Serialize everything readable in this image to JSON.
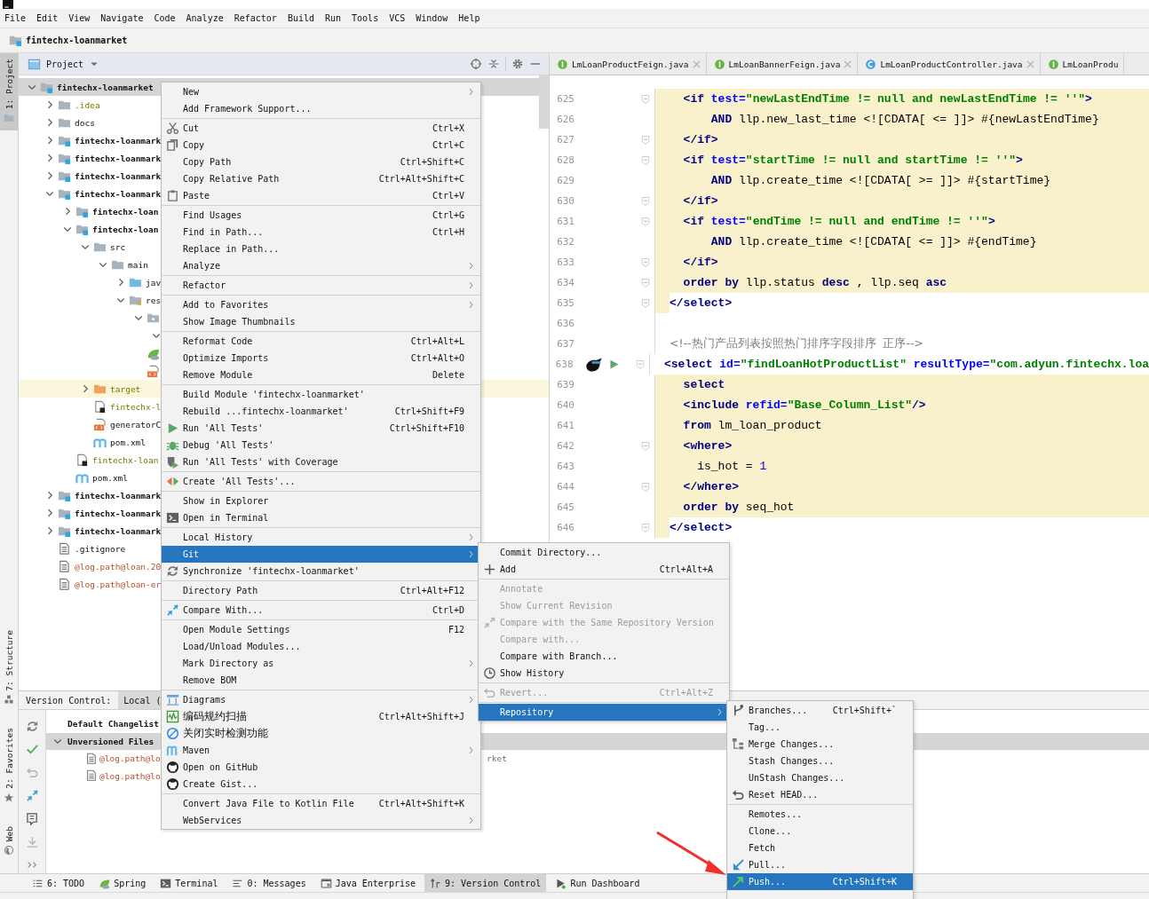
{
  "menu_bar": [
    "File",
    "Edit",
    "View",
    "Navigate",
    "Code",
    "Analyze",
    "Refactor",
    "Build",
    "Run",
    "Tools",
    "VCS",
    "Window",
    "Help"
  ],
  "breadcrumb": "fintechx-loanmarket",
  "tool_strip": [
    {
      "label": "1: Project",
      "selected": true
    },
    {
      "label": "7: Structure",
      "selected": false
    },
    {
      "label": "2: Favorites",
      "selected": false
    },
    {
      "label": "Web",
      "selected": false
    }
  ],
  "project": {
    "title": "Project",
    "tree": [
      {
        "name": "fintechx-loanmarket",
        "kind": "module",
        "selected": true,
        "expanded": true,
        "children": [
          {
            "name": ".idea",
            "kind": "folder",
            "ignored": true,
            "selected": false,
            "expanded": false
          },
          {
            "name": "docs",
            "kind": "folder",
            "selected": false,
            "expanded": false
          },
          {
            "name": "fintechx-loanmark",
            "kind": "module",
            "selected": false,
            "expanded": false
          },
          {
            "name": "fintechx-loanmark",
            "kind": "module",
            "selected": false,
            "expanded": false
          },
          {
            "name": "fintechx-loanmark",
            "kind": "module",
            "selected": false,
            "expanded": false
          },
          {
            "name": "fintechx-loanmark",
            "kind": "module",
            "selected": false,
            "expanded": true,
            "children": [
              {
                "name": "fintechx-loan",
                "kind": "module",
                "selected": false,
                "expanded": false
              },
              {
                "name": "fintechx-loan",
                "kind": "module",
                "selected": false,
                "expanded": true,
                "children": [
                  {
                    "name": "src",
                    "kind": "folder",
                    "selected": false,
                    "expanded": true,
                    "children": [
                      {
                        "name": "main",
                        "kind": "folder",
                        "selected": false,
                        "expanded": true,
                        "children": [
                          {
                            "name": "jav",
                            "kind": "source",
                            "selected": false,
                            "expanded": false
                          },
                          {
                            "name": "res",
                            "kind": "resources",
                            "selected": false,
                            "expanded": true,
                            "children": [
                              {
                                "kind": "package",
                                "selected": false,
                                "expanded": true,
                                "children": [
                                  {
                                    "selected": false,
                                    "expanded": true
                                  }
                                ]
                              },
                              {
                                "kind": "spring",
                                "selected": false
                              },
                              {
                                "kind": "xml",
                                "selected": false
                              }
                            ]
                          }
                        ]
                      }
                    ]
                  },
                  {
                    "name": "target",
                    "kind": "excluded",
                    "ignored": true,
                    "selected": false,
                    "highlighted": true,
                    "expanded": false
                  },
                  {
                    "name": "fintechx-l",
                    "kind": "iml",
                    "ignored": true,
                    "selected": false
                  },
                  {
                    "name": "generatorC",
                    "kind": "xml",
                    "selected": false
                  },
                  {
                    "name": "pom.xml",
                    "kind": "maven",
                    "selected": false
                  }
                ]
              },
              {
                "name": "fintechx-loan",
                "kind": "iml",
                "ignored": true,
                "selected": false
              },
              {
                "name": "pom.xml",
                "kind": "maven",
                "selected": false
              }
            ]
          },
          {
            "name": "fintechx-loanmark",
            "kind": "module",
            "selected": false,
            "expanded": false
          },
          {
            "name": "fintechx-loanmark",
            "kind": "module",
            "selected": false,
            "expanded": false
          },
          {
            "name": "fintechx-loanmark",
            "kind": "module",
            "selected": false,
            "expanded": false
          },
          {
            "name": ".gitignore",
            "kind": "text",
            "selected": false
          },
          {
            "name": "@log.path@loan.20",
            "kind": "text",
            "unversioned": true,
            "selected": false
          },
          {
            "name": "@log.path@loan-er",
            "kind": "text",
            "unversioned": true,
            "selected": false
          }
        ]
      }
    ]
  },
  "editor": {
    "tabs": [
      {
        "label": "LmLoanProductFeign.java",
        "kind": "interface",
        "closable": true
      },
      {
        "label": "LmLoanBannerFeign.java",
        "kind": "interface",
        "closable": true
      },
      {
        "label": "LmLoanProductController.java",
        "kind": "class",
        "closable": true
      },
      {
        "label": "LmLoanProdu",
        "kind": "interface",
        "closable": false
      }
    ],
    "lines": [
      {
        "number": "625",
        "kind": "full",
        "fold": true,
        "tokens": [
          {
            "kind": "t",
            "text": "  <if"
          },
          {
            "kind": "a",
            "text": " test="
          },
          {
            "kind": "s",
            "text": "\"newLastEndTime != null and newLastEndTime != ''\""
          },
          {
            "kind": "t",
            "text": ">"
          }
        ]
      },
      {
        "number": "626",
        "kind": "full",
        "fold": false,
        "tokens": [
          {
            "kind": "k",
            "text": "      AND"
          },
          {
            "kind": "p",
            "text": " llp.new_last_time <![CDATA[ <= ]]> #{newLastEndTime}"
          }
        ]
      },
      {
        "number": "627",
        "kind": "full",
        "fold": true,
        "tokens": [
          {
            "kind": "t",
            "text": "  </if>"
          }
        ]
      },
      {
        "number": "628",
        "kind": "full",
        "fold": true,
        "tokens": [
          {
            "kind": "t",
            "text": "  <if"
          },
          {
            "kind": "a",
            "text": " test="
          },
          {
            "kind": "s",
            "text": "\"startTime != null and startTime != ''\""
          },
          {
            "kind": "t",
            "text": ">"
          }
        ]
      },
      {
        "number": "629",
        "kind": "full",
        "fold": false,
        "tokens": [
          {
            "kind": "k",
            "text": "      AND"
          },
          {
            "kind": "p",
            "text": " llp.create_time <![CDATA[ >= ]]> #{startTime}"
          }
        ]
      },
      {
        "number": "630",
        "kind": "full",
        "fold": true,
        "tokens": [
          {
            "kind": "t",
            "text": "  </if>"
          }
        ]
      },
      {
        "number": "631",
        "kind": "full",
        "fold": true,
        "tokens": [
          {
            "kind": "t",
            "text": "  <if"
          },
          {
            "kind": "a",
            "text": " test="
          },
          {
            "kind": "s",
            "text": "\"endTime != null and endTime != ''\""
          },
          {
            "kind": "t",
            "text": ">"
          }
        ]
      },
      {
        "number": "632",
        "kind": "full",
        "fold": false,
        "tokens": [
          {
            "kind": "k",
            "text": "      AND"
          },
          {
            "kind": "p",
            "text": " llp.create_time <![CDATA[ <= ]]> #{endTime}"
          }
        ]
      },
      {
        "number": "633",
        "kind": "full",
        "fold": true,
        "tokens": [
          {
            "kind": "t",
            "text": "  </if>"
          }
        ]
      },
      {
        "number": "634",
        "kind": "full",
        "fold": true,
        "tokens": [
          {
            "kind": "k",
            "text": "  order by"
          },
          {
            "kind": "p",
            "text": " llp.status "
          },
          {
            "kind": "k",
            "text": "desc"
          },
          {
            "kind": "p",
            "text": " , llp.seq "
          },
          {
            "kind": "k",
            "text": "asc"
          }
        ]
      },
      {
        "number": "635",
        "kind": "edge",
        "fold": true,
        "tokens": [
          {
            "kind": "t",
            "text": "</select>"
          }
        ]
      },
      {
        "number": "636",
        "kind": "none",
        "fold": false
      },
      {
        "number": "637",
        "kind": "none",
        "fold": false,
        "tokens": [
          {
            "kind": "c",
            "text": "<!--热门产品列表按照热门排序字段排序  正序-->"
          }
        ]
      },
      {
        "number": "638",
        "kind": "none",
        "fold": true,
        "runnable": true,
        "tokens": [
          {
            "kind": "t",
            "text": "<select"
          },
          {
            "kind": "a",
            "text": " id="
          },
          {
            "kind": "s",
            "text": "\"findLoanHotProductList\""
          },
          {
            "kind": "a",
            "text": " resultType="
          },
          {
            "kind": "s",
            "text": "\"com.adyun.fintechx.loa"
          }
        ]
      },
      {
        "number": "639",
        "kind": "full",
        "fold": false,
        "tokens": [
          {
            "kind": "k",
            "text": "  select"
          }
        ]
      },
      {
        "number": "640",
        "kind": "full",
        "fold": false,
        "tokens": [
          {
            "kind": "t",
            "text": "  <include"
          },
          {
            "kind": "a",
            "text": " refid="
          },
          {
            "kind": "s",
            "text": "\"Base_Column_List\""
          },
          {
            "kind": "t",
            "text": "/>"
          }
        ]
      },
      {
        "number": "641",
        "kind": "full",
        "fold": false,
        "tokens": [
          {
            "kind": "k",
            "text": "  from"
          },
          {
            "kind": "p",
            "text": " lm_loan_product"
          }
        ]
      },
      {
        "number": "642",
        "kind": "full",
        "fold": true,
        "tokens": [
          {
            "kind": "t",
            "text": "  <where>"
          }
        ]
      },
      {
        "number": "643",
        "kind": "full",
        "fold": false,
        "tokens": [
          {
            "kind": "p",
            "text": "    is_hot = "
          },
          {
            "kind": "n",
            "text": "1"
          }
        ]
      },
      {
        "number": "644",
        "kind": "full",
        "fold": true,
        "tokens": [
          {
            "kind": "t",
            "text": "  </where>"
          }
        ]
      },
      {
        "number": "645",
        "kind": "full",
        "fold": false,
        "tokens": [
          {
            "kind": "k",
            "text": "  order by"
          },
          {
            "kind": "p",
            "text": " seq_hot"
          }
        ]
      },
      {
        "number": "646",
        "kind": "edge",
        "fold": true,
        "tokens": [
          {
            "kind": "t",
            "text": "</select>"
          }
        ]
      }
    ]
  },
  "version_control": {
    "title": "Version Control:",
    "tabs": [
      {
        "label": "Local (",
        "selected": true
      }
    ],
    "groups": [
      {
        "label": "Default Changelist",
        "selected": false
      },
      {
        "label": "Unversioned Files",
        "selected": true,
        "expanded": true,
        "files": [
          {
            "name": "@log.path@lo",
            "path": "rket"
          },
          {
            "name": "@log.path@lo"
          }
        ]
      }
    ]
  },
  "bottom_bar": [
    {
      "label": "6: TODO",
      "selected": false
    },
    {
      "label": "Spring",
      "selected": false
    },
    {
      "label": "Terminal",
      "selected": false
    },
    {
      "label": "0: Messages",
      "selected": false
    },
    {
      "label": "Java Enterprise",
      "selected": false
    },
    {
      "label": "9: Version Control",
      "selected": true
    },
    {
      "label": "Run Dashboard",
      "selected": false
    }
  ],
  "context_menu": {
    "items": [
      {
        "kind": "item",
        "label": "New",
        "submenu": true,
        "selected": false
      },
      {
        "kind": "item",
        "label": "Add Framework Support...",
        "submenu": false,
        "selected": false
      },
      {
        "kind": "separator"
      },
      {
        "kind": "item",
        "label": "Cut",
        "shortcut": "Ctrl+X",
        "submenu": false,
        "selected": false
      },
      {
        "kind": "item",
        "label": "Copy",
        "shortcut": "Ctrl+C",
        "submenu": false,
        "selected": false
      },
      {
        "kind": "item",
        "label": "Copy Path",
        "shortcut": "Ctrl+Shift+C",
        "submenu": false,
        "selected": false
      },
      {
        "kind": "item",
        "label": "Copy Relative Path",
        "shortcut": "Ctrl+Alt+Shift+C",
        "submenu": false,
        "selected": false
      },
      {
        "kind": "item",
        "label": "Paste",
        "shortcut": "Ctrl+V",
        "submenu": false,
        "selected": false
      },
      {
        "kind": "separator"
      },
      {
        "kind": "item",
        "label": "Find Usages",
        "shortcut": "Ctrl+G",
        "submenu": false,
        "selected": false
      },
      {
        "kind": "item",
        "label": "Find in Path...",
        "shortcut": "Ctrl+H",
        "submenu": false,
        "selected": false
      },
      {
        "kind": "item",
        "label": "Replace in Path...",
        "submenu": false,
        "selected": false
      },
      {
        "kind": "item",
        "label": "Analyze",
        "submenu": true,
        "selected": false
      },
      {
        "kind": "separator"
      },
      {
        "kind": "item",
        "label": "Refactor",
        "submenu": true,
        "selected": false
      },
      {
        "kind": "separator"
      },
      {
        "kind": "item",
        "label": "Add to Favorites",
        "submenu": true,
        "selected": false
      },
      {
        "kind": "item",
        "label": "Show Image Thumbnails",
        "submenu": false,
        "selected": false
      },
      {
        "kind": "separator"
      },
      {
        "kind": "item",
        "label": "Reformat Code",
        "shortcut": "Ctrl+Alt+L",
        "submenu": false,
        "selected": false
      },
      {
        "kind": "item",
        "label": "Optimize Imports",
        "shortcut": "Ctrl+Alt+O",
        "submenu": false,
        "selected": false
      },
      {
        "kind": "item",
        "label": "Remove Module",
        "shortcut": "Delete",
        "submenu": false,
        "selected": false
      },
      {
        "kind": "separator"
      },
      {
        "kind": "item",
        "label": "Build Module 'fintechx-loanmarket'",
        "submenu": false,
        "selected": false
      },
      {
        "kind": "item",
        "label": "Rebuild ...fintechx-loanmarket'",
        "shortcut": "Ctrl+Shift+F9",
        "submenu": false,
        "selected": false
      },
      {
        "kind": "item",
        "label": "Run 'All Tests'",
        "shortcut": "Ctrl+Shift+F10",
        "submenu": false,
        "selected": false
      },
      {
        "kind": "item",
        "label": "Debug 'All Tests'",
        "submenu": false,
        "selected": false
      },
      {
        "kind": "item",
        "label": "Run 'All Tests' with Coverage",
        "submenu": false,
        "selected": false
      },
      {
        "kind": "separator"
      },
      {
        "kind": "item",
        "label": "Create 'All Tests'...",
        "submenu": false,
        "selected": false
      },
      {
        "kind": "separator"
      },
      {
        "kind": "item",
        "label": "Show in Explorer",
        "submenu": false,
        "selected": false
      },
      {
        "kind": "item",
        "label": "Open in Terminal",
        "submenu": false,
        "selected": false
      },
      {
        "kind": "separator"
      },
      {
        "kind": "item",
        "label": "Local History",
        "submenu": true,
        "selected": false
      },
      {
        "kind": "item",
        "label": "Git",
        "submenu": true,
        "selected": true
      },
      {
        "kind": "item",
        "label": "Synchronize 'fintechx-loanmarket'",
        "submenu": false,
        "selected": false
      },
      {
        "kind": "separator"
      },
      {
        "kind": "item",
        "label": "Directory Path",
        "shortcut": "Ctrl+Alt+F12",
        "submenu": false,
        "selected": false
      },
      {
        "kind": "separator"
      },
      {
        "kind": "item",
        "label": "Compare With...",
        "shortcut": "Ctrl+D",
        "submenu": false,
        "selected": false
      },
      {
        "kind": "separator"
      },
      {
        "kind": "item",
        "label": "Open Module Settings",
        "shortcut": "F12",
        "submenu": false,
        "selected": false
      },
      {
        "kind": "item",
        "label": "Load/Unload Modules...",
        "submenu": false,
        "selected": false
      },
      {
        "kind": "item",
        "label": "Mark Directory as",
        "submenu": true,
        "selected": false
      },
      {
        "kind": "item",
        "label": "Remove BOM",
        "submenu": false,
        "selected": false
      },
      {
        "kind": "separator"
      },
      {
        "kind": "item",
        "label": "Diagrams",
        "submenu": true,
        "selected": false
      },
      {
        "kind": "item",
        "label": "编码规约扫描",
        "shortcut": "Ctrl+Alt+Shift+J",
        "submenu": false,
        "selected": false
      },
      {
        "kind": "item",
        "label": "关闭实时检测功能",
        "submenu": false,
        "selected": false
      },
      {
        "kind": "item",
        "label": "Maven",
        "submenu": true,
        "selected": false
      },
      {
        "kind": "item",
        "label": "Open on GitHub",
        "submenu": false,
        "selected": false
      },
      {
        "kind": "item",
        "label": "Create Gist...",
        "submenu": false,
        "selected": false
      },
      {
        "kind": "separator"
      },
      {
        "kind": "item",
        "label": "Convert Java File to Kotlin File",
        "shortcut": "Ctrl+Alt+Shift+K",
        "submenu": false,
        "selected": false
      },
      {
        "kind": "item",
        "label": "WebServices",
        "submenu": true,
        "selected": false
      }
    ]
  },
  "git_menu": {
    "items": [
      {
        "kind": "item",
        "label": "Commit Directory...",
        "disabled": false,
        "submenu": false,
        "selected": false
      },
      {
        "kind": "item",
        "label": "Add",
        "shortcut": "Ctrl+Alt+A",
        "disabled": false,
        "submenu": false,
        "selected": false
      },
      {
        "kind": "separator"
      },
      {
        "kind": "item",
        "label": "Annotate",
        "disabled": true,
        "submenu": false,
        "selected": false
      },
      {
        "kind": "item",
        "label": "Show Current Revision",
        "disabled": true,
        "submenu": false,
        "selected": false
      },
      {
        "kind": "item",
        "label": "Compare with the Same Repository Version",
        "disabled": true,
        "submenu": false,
        "selected": false
      },
      {
        "kind": "item",
        "label": "Compare with...",
        "disabled": true,
        "submenu": false,
        "selected": false
      },
      {
        "kind": "item",
        "label": "Compare with Branch...",
        "disabled": false,
        "submenu": false,
        "selected": false
      },
      {
        "kind": "item",
        "label": "Show History",
        "disabled": false,
        "submenu": false,
        "selected": false
      },
      {
        "kind": "separator"
      },
      {
        "kind": "item",
        "label": "Revert...",
        "shortcut": "Ctrl+Alt+Z",
        "disabled": true,
        "submenu": false,
        "selected": false
      },
      {
        "kind": "separator"
      },
      {
        "kind": "item",
        "label": "Repository",
        "disabled": false,
        "submenu": true,
        "selected": true
      }
    ]
  },
  "repository_menu": {
    "items": [
      {
        "kind": "item",
        "label": "Branches...",
        "shortcut": "Ctrl+Shift+`",
        "selected": false
      },
      {
        "kind": "item",
        "label": "Tag...",
        "selected": false
      },
      {
        "kind": "item",
        "label": "Merge Changes...",
        "selected": false
      },
      {
        "kind": "item",
        "label": "Stash Changes...",
        "selected": false
      },
      {
        "kind": "item",
        "label": "UnStash Changes...",
        "selected": false
      },
      {
        "kind": "item",
        "label": "Reset HEAD...",
        "selected": false
      },
      {
        "kind": "separator"
      },
      {
        "kind": "item",
        "label": "Remotes...",
        "selected": false
      },
      {
        "kind": "item",
        "label": "Clone...",
        "selected": false
      },
      {
        "kind": "item",
        "label": "Fetch",
        "selected": false
      },
      {
        "kind": "item",
        "label": "Pull...",
        "selected": false
      },
      {
        "kind": "item",
        "label": "Push...",
        "shortcut": "Ctrl+Shift+K",
        "selected": true
      }
    ]
  }
}
